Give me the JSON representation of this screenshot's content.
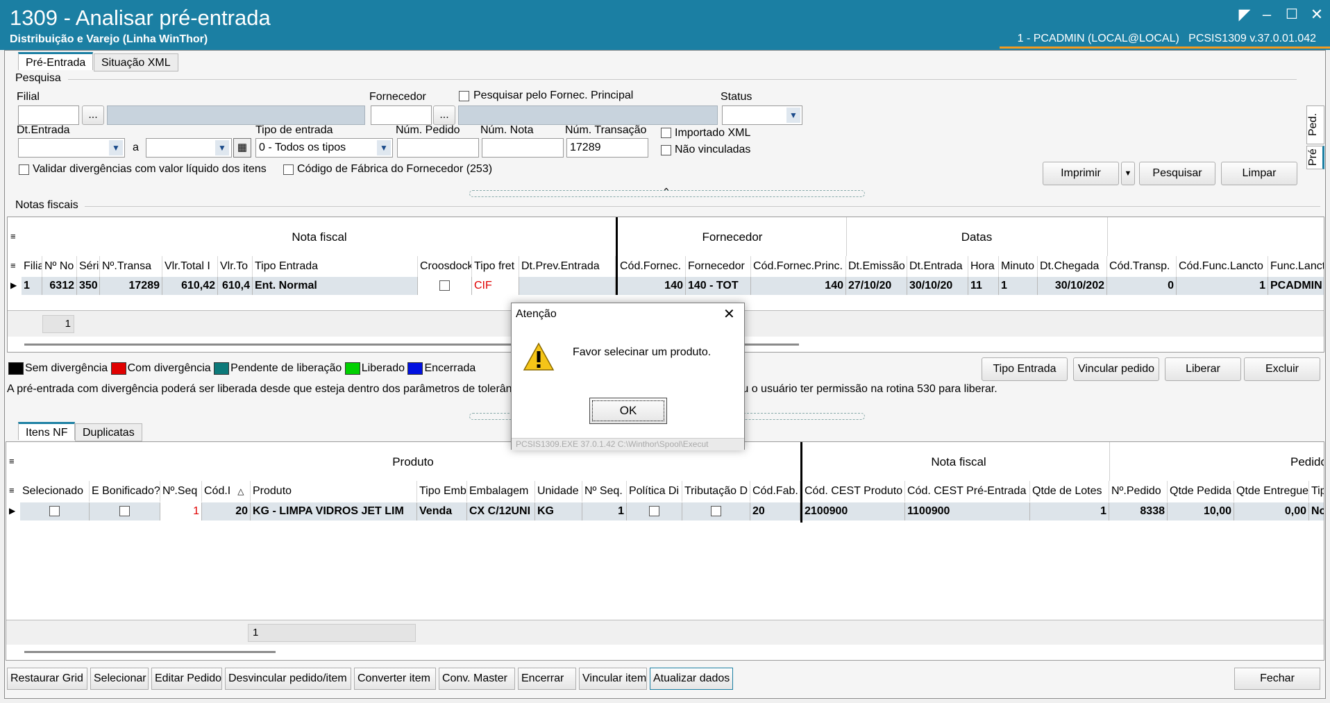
{
  "window": {
    "title": "1309 - Analisar pré-entrada",
    "subtitle": "Distribuição e Varejo (Linha WinThor)",
    "user_info": "1 - PCADMIN (LOCAL@LOCAL)",
    "app_version": "PCSIS1309  v.37.0.01.042"
  },
  "top_tabs": [
    "Pré-Entrada",
    "Situação XML"
  ],
  "side_tabs": [
    "Ped.",
    "Pré"
  ],
  "pesquisa": {
    "section": "Pesquisa",
    "filial_label": "Filial",
    "fornecedor_label": "Fornecedor",
    "pesquisar_fornec": "Pesquisar pelo Fornec. Principal",
    "status_label": "Status",
    "dt_entrada_label": "Dt.Entrada",
    "a_label": "a",
    "tipo_entrada_label": "Tipo de entrada",
    "tipo_entrada_value": "0 - Todos os tipos",
    "num_pedido_label": "Núm. Pedido",
    "num_nota_label": "Núm. Nota",
    "num_transacao_label": "Núm. Transação",
    "num_transacao_value": "17289",
    "importado_xml": "Importado XML",
    "nao_vinculadas": "Não vinculadas",
    "validar_div": "Validar divergências com valor líquido dos itens",
    "cod_fabrica": "Código de Fábrica do Fornecedor (253)",
    "ellipsis": "...",
    "btn_imprimir": "Imprimir",
    "btn_pesquisar": "Pesquisar",
    "btn_limpar": "Limpar"
  },
  "notas": {
    "section": "Notas fiscais",
    "groups": [
      "Nota fiscal",
      "Fornecedor",
      "Datas"
    ],
    "columns": [
      "Filia",
      "Nº No",
      "Séri",
      "Nº.Transa",
      "Vlr.Total I",
      "Vlr.To",
      "Tipo Entrada",
      "Croosdock",
      "Tipo fret",
      "Dt.Prev.Entrada",
      "Cód.Fornec.",
      "Fornecedor",
      "Cód.Fornec.Princ.",
      "Dt.Emissão",
      "Dt.Entrada",
      "Hora",
      "Minuto",
      "Dt.Chegada",
      "Cód.Transp.",
      "Cód.Func.Lancto",
      "Func.Lancto"
    ],
    "row": [
      "1",
      "6312",
      "350",
      "17289",
      "610,42",
      "610,4",
      "Ent. Normal",
      "",
      "CIF",
      "",
      "140",
      "140 - TOT",
      "140",
      "27/10/20",
      "30/10/20",
      "11",
      "1",
      "30/10/202",
      "0",
      "1",
      "PCADMIN"
    ],
    "footer_count": "1"
  },
  "legend": [
    "Sem divergência",
    "Com divergência",
    "Pendente de liberação",
    "Liberado",
    "Encerrada"
  ],
  "legend_colors": [
    "#000000",
    "#e00000",
    "#0d7a7a",
    "#00d000",
    "#0010e0"
  ],
  "info_text": "A pré-entrada com divergência poderá ser liberada desde que esteja dentro dos parâmetros de tolerância de preço e quantidade (pedido x entrada) ou o usuário ter permissão na rotina 530 para liberar.",
  "notas_buttons": [
    "Tipo Entrada",
    "Vincular pedido",
    "Liberar",
    "Excluir"
  ],
  "bottom_tabs": [
    "Itens NF",
    "Duplicatas"
  ],
  "itens": {
    "groups": [
      "Produto",
      "Nota fiscal",
      "Pedido"
    ],
    "columns": [
      "Selecionado",
      "E Bonificado?",
      "Nº.Seq",
      "Cód.I",
      "Produto",
      "Tipo Emb",
      "Embalagem",
      "Unidade",
      "Nº Seq.",
      "Política Di",
      "Tributação D",
      "Cód.Fab.",
      "Cód. CEST Produto",
      "Cód. CEST Pré-Entrada",
      "Qtde de Lotes",
      "Nº.Pedido",
      "Qtde Pedida",
      "Qtde Entregue",
      "Tipo"
    ],
    "row": [
      "",
      "",
      "1",
      "20",
      "KG - LIMPA VIDROS JET LIM",
      "Venda",
      "CX C/12UNI",
      "KG",
      "1",
      "",
      "",
      "20",
      "2100900",
      "1100900",
      "1",
      "8338",
      "10,00",
      "0,00",
      "Nor"
    ],
    "footer_count": "1"
  },
  "bottom_buttons": [
    "Restaurar Grid",
    "Selecionar",
    "Editar Pedido",
    "Desvincular pedido/item",
    "Converter item",
    "Conv. Master",
    "Encerrar",
    "Vincular item",
    "Atualizar dados"
  ],
  "close_button": "Fechar",
  "dialog": {
    "title": "Atenção",
    "message": "Favor selecinar um produto.",
    "ok": "OK",
    "footer": "PCSIS1309.EXE 37.0.1.42 C:\\Winthor\\Spool\\Execut"
  }
}
